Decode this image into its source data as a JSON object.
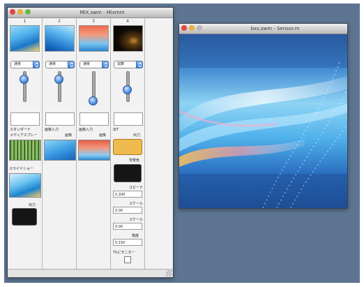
{
  "mixer_window": {
    "title": "MIX.swm - Mixmm",
    "columns": [
      {
        "number": "1",
        "blend_mode": "通常",
        "slider_value": 0.85,
        "label_under_preview": "スタンダード",
        "label_right": "メディアスプレー"
      },
      {
        "number": "2",
        "blend_mode": "通常",
        "slider_value": 0.85,
        "label_under_preview": "画像入力",
        "label_right": "画像"
      },
      {
        "number": "3",
        "blend_mode": "通常",
        "slider_value": 0.15,
        "label_under_preview": "画像入力",
        "label_right": "画像"
      },
      {
        "number": "4",
        "blend_mode": "加算",
        "slider_value": 0.55,
        "label_under_preview": "出T",
        "label_right": "出力"
      }
    ],
    "col1_extra": {
      "row_label": "スライドショー",
      "output_label": "出力"
    },
    "col4_params": {
      "top_label": "背景色",
      "fields": [
        {
          "label": "スピード",
          "value": "0.200"
        },
        {
          "label": "スケール",
          "value": "0.00"
        },
        {
          "label": "スケール",
          "value": "0.00"
        },
        {
          "label": "角度",
          "value": "0.150"
        }
      ],
      "checkbox_label": "TVにモニター"
    }
  },
  "output_window": {
    "title": "bxs.swm - Sensor.m"
  },
  "colors": {
    "desktop": "#5e7592",
    "window_bg": "#ededed",
    "swatch_orange": "#f0bb4e",
    "swatch_black": "#151515",
    "accent_blue": "#3f7fd1"
  }
}
